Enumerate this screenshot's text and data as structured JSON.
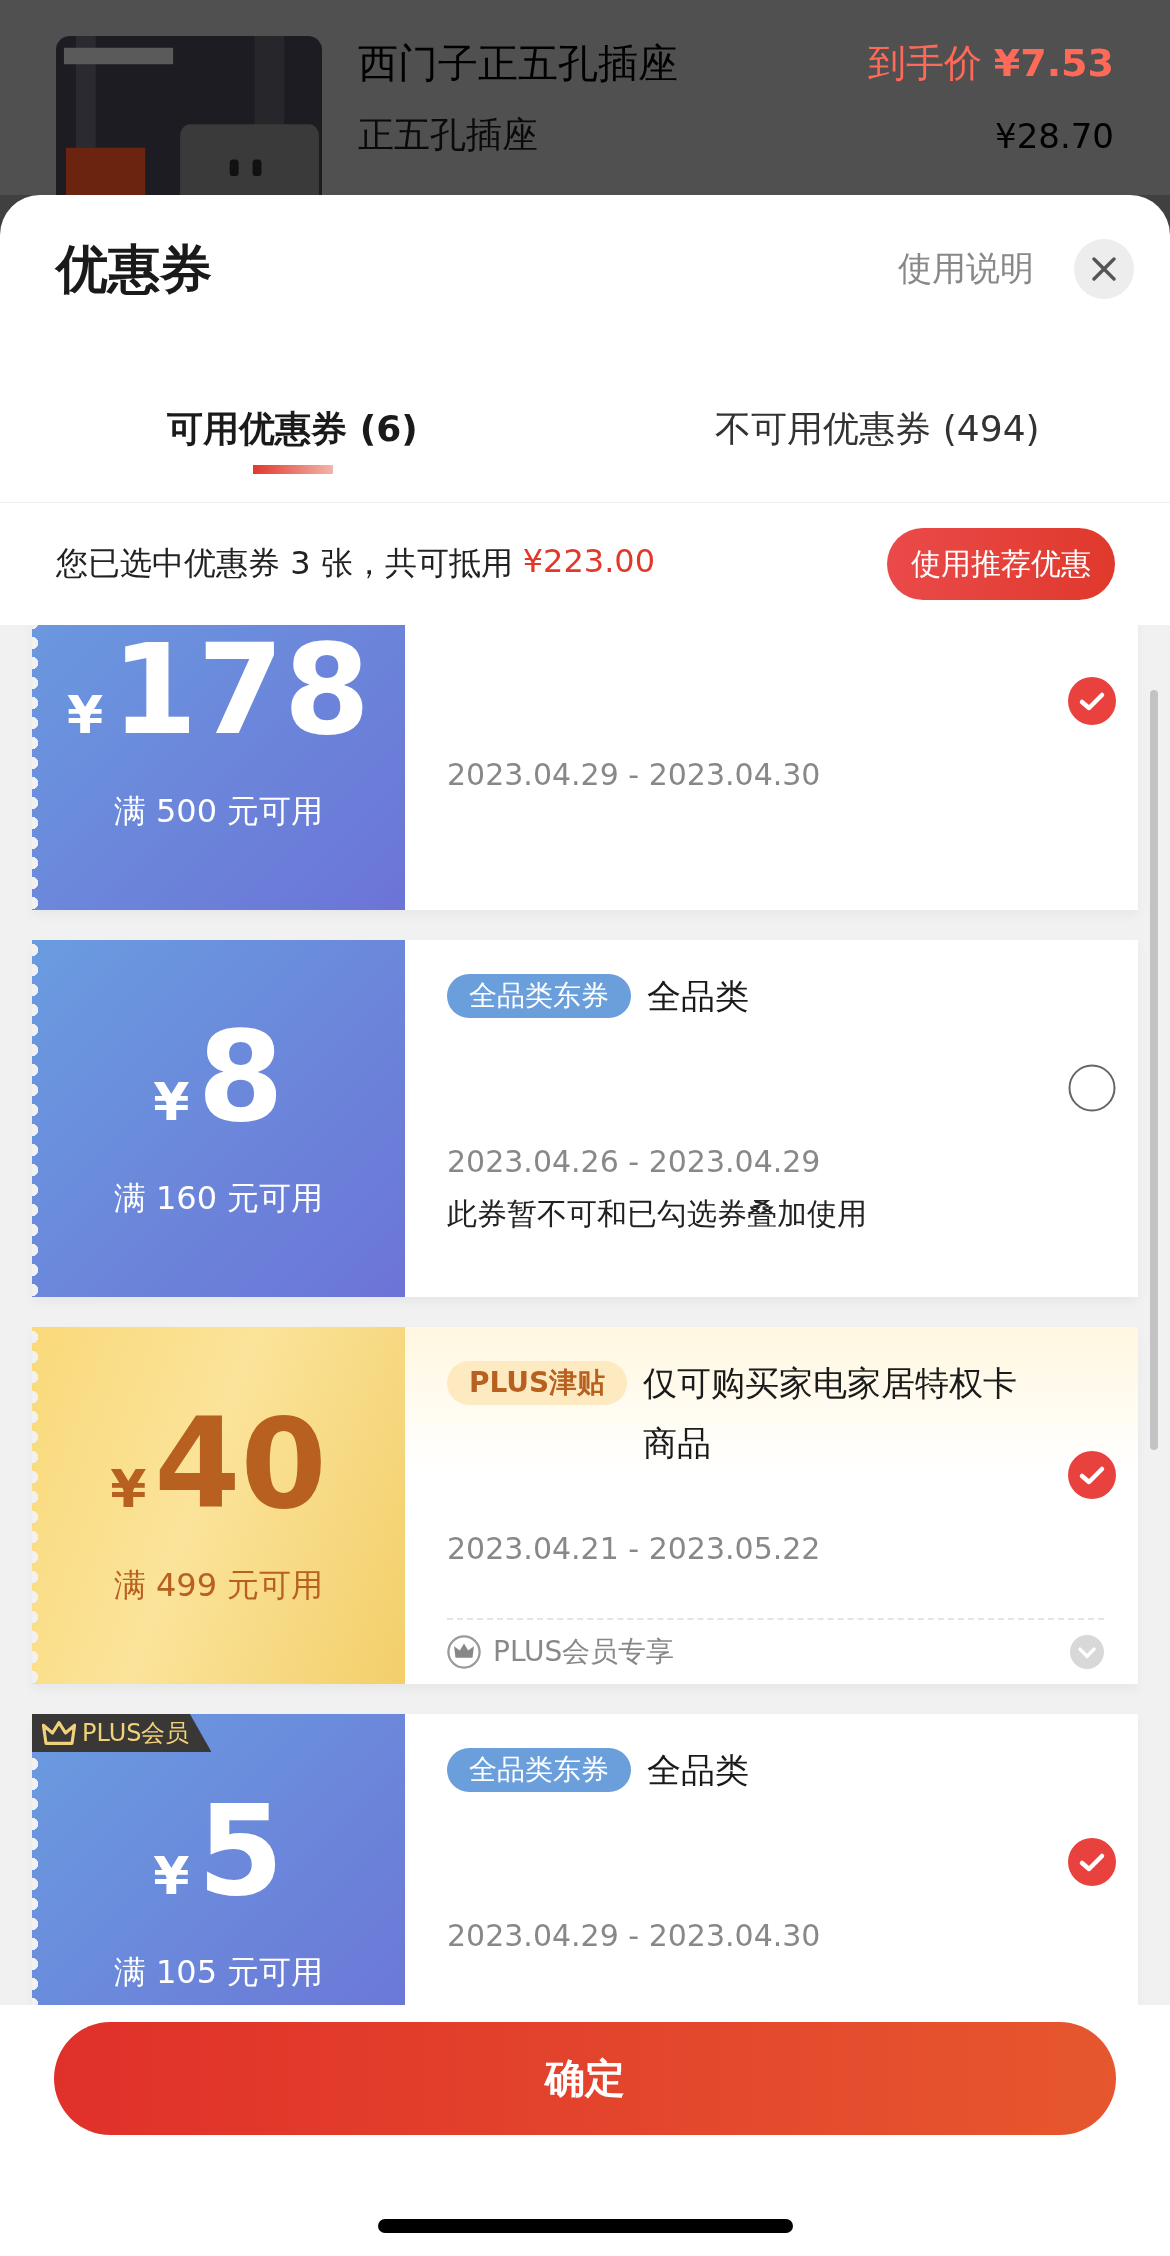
{
  "product": {
    "kind": "picture",
    "name": "西门子正五孔插座",
    "price_label": "到手价",
    "price": "¥7.53",
    "subtitle": "正五孔插座",
    "original_price": "¥28.70"
  },
  "sheet": {
    "title": "优惠券",
    "help_link": "使用说明"
  },
  "tabs": [
    {
      "label": "可用优惠券 (6)",
      "selected": true
    },
    {
      "label": "不可用优惠券 (494)",
      "selected": false
    }
  ],
  "summary": {
    "text": "您已选中优惠券 3 张，共可抵用",
    "amount": "¥223.00",
    "recommend_button": "使用推荐优惠"
  },
  "coupons": [
    {
      "kind": "blue",
      "currency": "¥",
      "amount": "178",
      "condition": "满 500 元可用",
      "dates": "2023.04.29 - 2023.04.30",
      "selected": true
    },
    {
      "kind": "blue",
      "currency": "¥",
      "amount": "8",
      "condition": "满 160 元可用",
      "tag": "全品类东券",
      "title": "全品类",
      "dates": "2023.04.26 - 2023.04.29",
      "note": "此券暂不可和已勾选券叠加使用",
      "selected": false
    },
    {
      "kind": "gold",
      "currency": "¥",
      "amount": "40",
      "condition": "满 499 元可用",
      "tag": "PLUS津贴",
      "title": "仅可购买家电家居特权卡商品",
      "dates": "2023.04.21 - 2023.05.22",
      "footer": "PLUS会员专享",
      "selected": true
    },
    {
      "kind": "blue",
      "badge": "PLUS会员",
      "currency": "¥",
      "amount": "5",
      "condition": "满 105 元可用",
      "tag": "全品类东券",
      "title": "全品类",
      "dates": "2023.04.29 - 2023.04.30",
      "selected": true
    }
  ],
  "confirm_button": "确定"
}
